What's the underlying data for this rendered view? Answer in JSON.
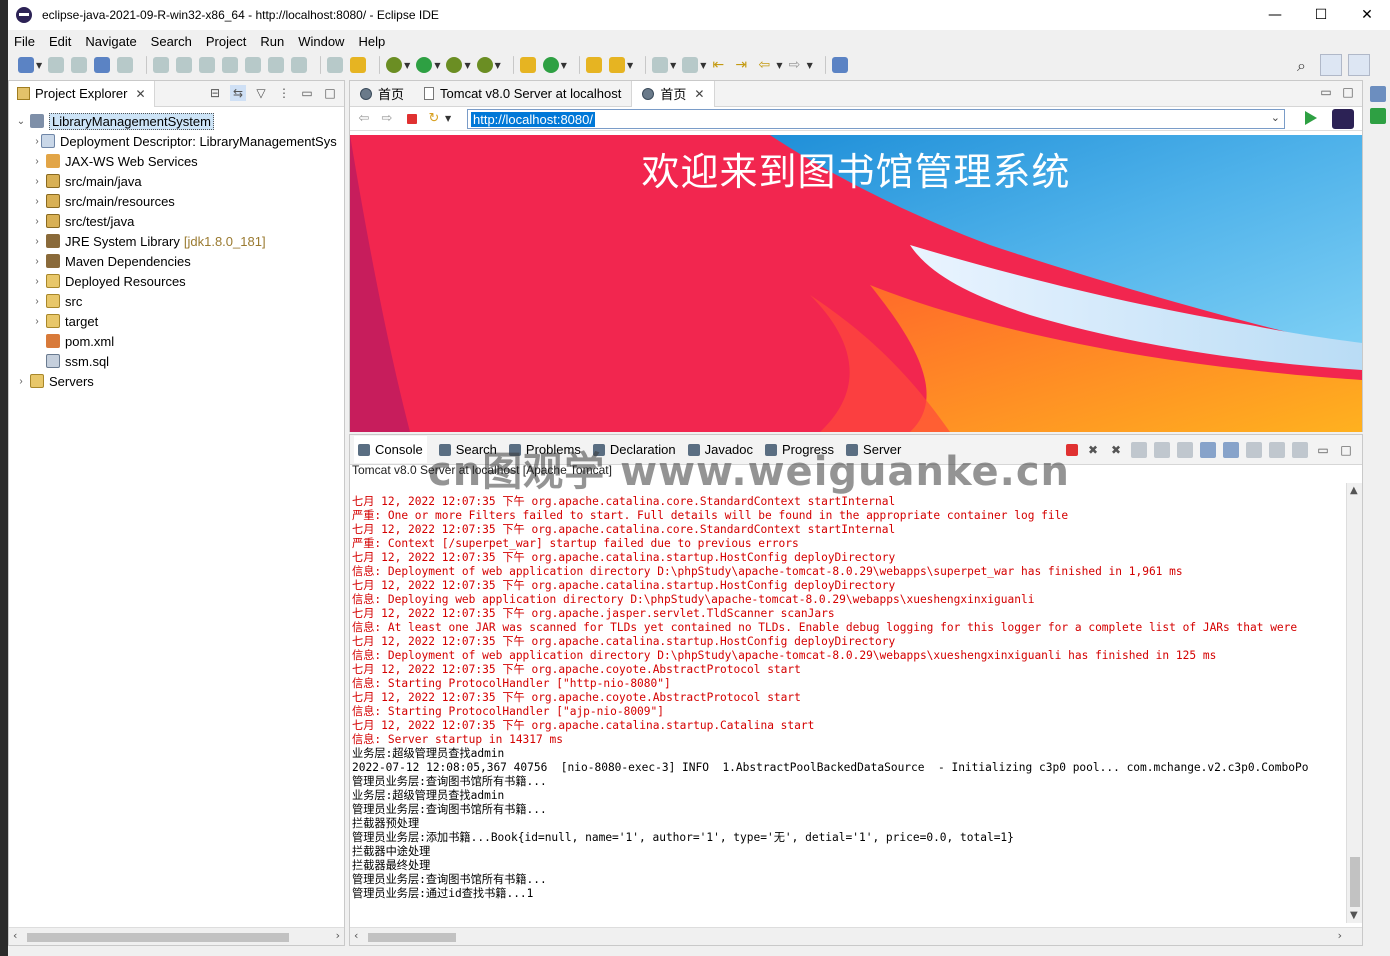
{
  "window": {
    "title": "eclipse-java-2021-09-R-win32-x86_64 - http://localhost:8080/ - Eclipse IDE",
    "minimize": "—",
    "maximize": "☐",
    "close": "✕"
  },
  "menu": [
    "File",
    "Edit",
    "Navigate",
    "Search",
    "Project",
    "Run",
    "Window",
    "Help"
  ],
  "project_explorer": {
    "tab_label": "Project Explorer",
    "close": "✕",
    "items": [
      {
        "label": "LibraryManagementSystem",
        "twisty": "⌄",
        "icon": "project-icon",
        "indent": 0,
        "selected": true
      },
      {
        "label": "Deployment Descriptor: LibraryManagementSys",
        "twisty": "›",
        "icon": "deployment-descriptor-icon",
        "indent": 1
      },
      {
        "label": "JAX-WS Web Services",
        "twisty": "›",
        "icon": "web-services-icon",
        "indent": 1
      },
      {
        "label": "src/main/java",
        "twisty": "›",
        "icon": "source-folder-icon",
        "indent": 1
      },
      {
        "label": "src/main/resources",
        "twisty": "›",
        "icon": "source-folder-icon",
        "indent": 1
      },
      {
        "label": "src/test/java",
        "twisty": "›",
        "icon": "source-folder-icon",
        "indent": 1
      },
      {
        "label": "JRE System Library",
        "deco": "[jdk1.8.0_181]",
        "twisty": "›",
        "icon": "library-icon",
        "indent": 1
      },
      {
        "label": "Maven Dependencies",
        "twisty": "›",
        "icon": "library-icon",
        "indent": 1
      },
      {
        "label": "Deployed Resources",
        "twisty": "›",
        "icon": "folder-icon",
        "indent": 1
      },
      {
        "label": "src",
        "twisty": "›",
        "icon": "folder-icon",
        "indent": 1
      },
      {
        "label": "target",
        "twisty": "›",
        "icon": "folder-icon",
        "indent": 1
      },
      {
        "label": "pom.xml",
        "twisty": "",
        "icon": "xml-file-icon",
        "indent": 1
      },
      {
        "label": "ssm.sql",
        "twisty": "",
        "icon": "sql-file-icon",
        "indent": 1
      },
      {
        "label": "Servers",
        "twisty": "›",
        "icon": "folder-icon",
        "indent": 0
      }
    ]
  },
  "editor": {
    "tabs": [
      {
        "label": "首页",
        "icon": "globe-icon",
        "active": false
      },
      {
        "label": "Tomcat v8.0 Server at localhost",
        "icon": "page-icon",
        "active": false
      },
      {
        "label": "首页",
        "icon": "globe-icon",
        "active": true,
        "close": "✕"
      }
    ],
    "url": "http://localhost:8080/",
    "page_heading": "欢迎来到图书馆管理系统"
  },
  "console": {
    "tabs": [
      "Console",
      "Search",
      "Problems",
      "Declaration",
      "Javadoc",
      "Progress",
      "Server"
    ],
    "description": "Tomcat v8.0 Server at localhost [Apache Tomcat]",
    "watermark": "cn图观学 www.weiguanke.cn",
    "lines": [
      {
        "t": "七月 12, 2022 12:07:35 下午 org.apache.catalina.core.StandardContext startInternal",
        "c": "red"
      },
      {
        "t": "严重: One or more Filters failed to start. Full details will be found in the appropriate container log file",
        "c": "red"
      },
      {
        "t": "七月 12, 2022 12:07:35 下午 org.apache.catalina.core.StandardContext startInternal",
        "c": "red"
      },
      {
        "t": "严重: Context [/superpet_war] startup failed due to previous errors",
        "c": "red"
      },
      {
        "t": "七月 12, 2022 12:07:35 下午 org.apache.catalina.startup.HostConfig deployDirectory",
        "c": "red"
      },
      {
        "t": "信息: Deployment of web application directory D:\\phpStudy\\apache-tomcat-8.0.29\\webapps\\superpet_war has finished in 1,961 ms",
        "c": "red"
      },
      {
        "t": "七月 12, 2022 12:07:35 下午 org.apache.catalina.startup.HostConfig deployDirectory",
        "c": "red"
      },
      {
        "t": "信息: Deploying web application directory D:\\phpStudy\\apache-tomcat-8.0.29\\webapps\\xueshengxinxiguanli",
        "c": "red"
      },
      {
        "t": "七月 12, 2022 12:07:35 下午 org.apache.jasper.servlet.TldScanner scanJars",
        "c": "red"
      },
      {
        "t": "信息: At least one JAR was scanned for TLDs yet contained no TLDs. Enable debug logging for this logger for a complete list of JARs that were",
        "c": "red"
      },
      {
        "t": "七月 12, 2022 12:07:35 下午 org.apache.catalina.startup.HostConfig deployDirectory",
        "c": "red"
      },
      {
        "t": "信息: Deployment of web application directory D:\\phpStudy\\apache-tomcat-8.0.29\\webapps\\xueshengxinxiguanli has finished in 125 ms",
        "c": "red"
      },
      {
        "t": "七月 12, 2022 12:07:35 下午 org.apache.coyote.AbstractProtocol start",
        "c": "red"
      },
      {
        "t": "信息: Starting ProtocolHandler [\"http-nio-8080\"]",
        "c": "red"
      },
      {
        "t": "七月 12, 2022 12:07:35 下午 org.apache.coyote.AbstractProtocol start",
        "c": "red"
      },
      {
        "t": "信息: Starting ProtocolHandler [\"ajp-nio-8009\"]",
        "c": "red"
      },
      {
        "t": "七月 12, 2022 12:07:35 下午 org.apache.catalina.startup.Catalina start",
        "c": "red"
      },
      {
        "t": "信息: Server startup in 14317 ms",
        "c": "red"
      },
      {
        "t": "业务层:超级管理员查找admin",
        "c": "blk"
      },
      {
        "t": "2022-07-12 12:08:05,367 40756  [nio-8080-exec-3] INFO  1.AbstractPoolBackedDataSource  - Initializing c3p0 pool... com.mchange.v2.c3p0.ComboPo",
        "c": "blk"
      },
      {
        "t": "管理员业务层:查询图书馆所有书籍...",
        "c": "blk"
      },
      {
        "t": "业务层:超级管理员查找admin",
        "c": "blk"
      },
      {
        "t": "管理员业务层:查询图书馆所有书籍...",
        "c": "blk"
      },
      {
        "t": "拦截器预处理",
        "c": "blk"
      },
      {
        "t": "管理员业务层:添加书籍...Book{id=null, name='1', author='1', type='无', detial='1', price=0.0, total=1}",
        "c": "blk"
      },
      {
        "t": "拦截器中途处理",
        "c": "blk"
      },
      {
        "t": "拦截器最终处理",
        "c": "blk"
      },
      {
        "t": "管理员业务层:查询图书馆所有书籍...",
        "c": "blk"
      },
      {
        "t": "管理员业务层:通过id查找书籍...1",
        "c": "blk"
      }
    ]
  }
}
